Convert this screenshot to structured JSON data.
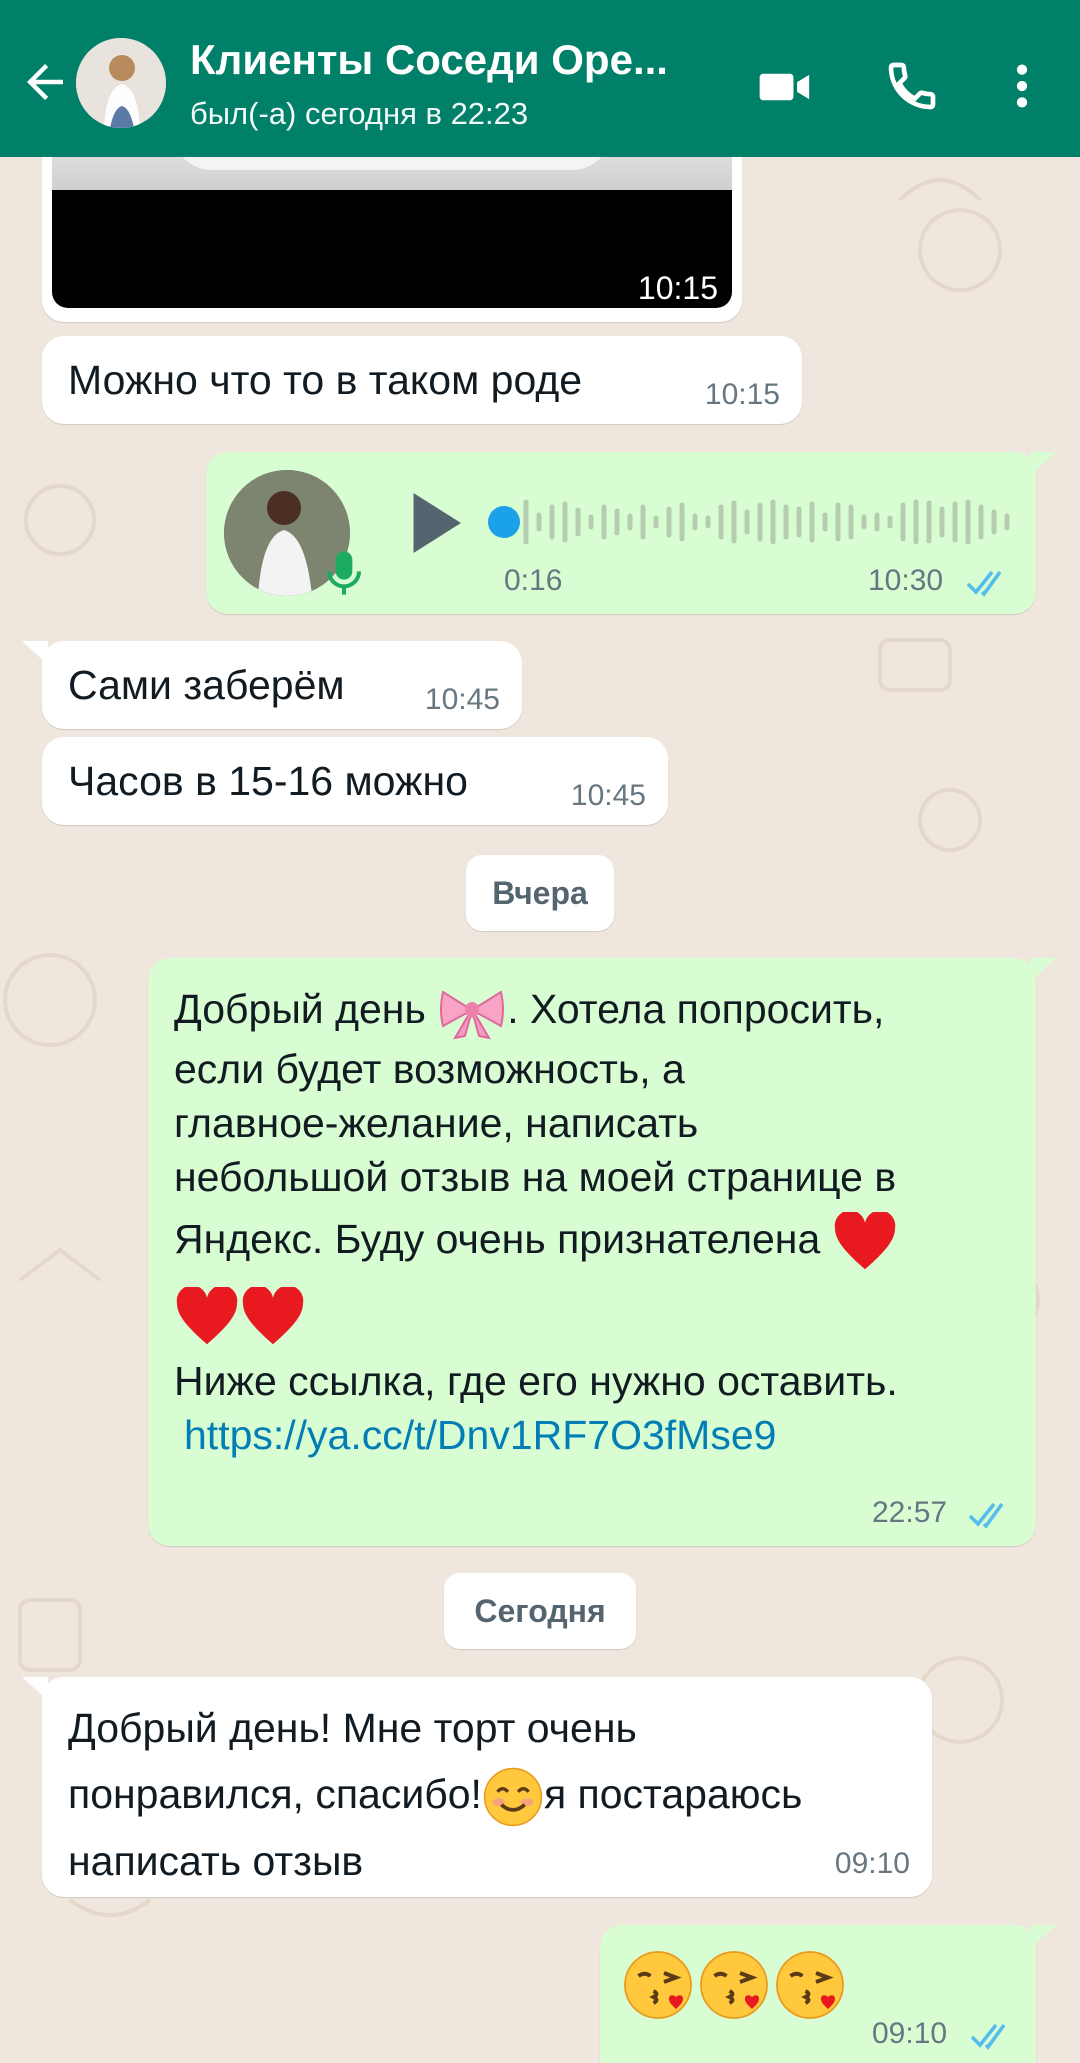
{
  "header": {
    "contact_name": "Клиенты Соседи Оре...",
    "last_seen": "был(-а) сегодня в 22:23",
    "icons": [
      "back-arrow-icon",
      "video-call-icon",
      "phone-call-icon",
      "more-vert-icon"
    ]
  },
  "messages": {
    "video_time": "10:15",
    "m1_text": "Можно что то в таком роде",
    "m1_time": "10:15",
    "voice_duration": "0:16",
    "voice_time": "10:30",
    "m2_text": "Сами заберём",
    "m2_time": "10:45",
    "m3_text": "Часов в 15-16 можно",
    "m3_time": "10:45",
    "date_yesterday": "Вчера",
    "long_line1": "Добрый день",
    "long_line1b": ".  Хотела попросить,",
    "long_line2": "если будет возможность,  а",
    "long_line3": "главное-желание,  написать",
    "long_line4": "небольшой отзыв на моей странице в",
    "long_line5": "Яндекс.  Буду очень признателена",
    "long_line7": "Ниже ссылка, где его нужно оставить.",
    "long_link": "https://ya.cc/t/Dnv1RF7O3fMse9",
    "long_time": "22:57",
    "date_today": "Сегодня",
    "reply_line1": "Добрый день! Мне торт очень",
    "reply_line2a": "понравился, спасибо!",
    "reply_line2b": "я постараюсь",
    "reply_line3": "написать отзыв",
    "reply_time": "09:10",
    "kiss_time": "09:10"
  },
  "colors": {
    "header": "#008069",
    "outgoing_bubble": "#d9fdd3",
    "incoming_bubble": "#ffffff",
    "background": "#efe7dd",
    "read_ticks": "#53bdeb",
    "link": "#027eb5"
  }
}
